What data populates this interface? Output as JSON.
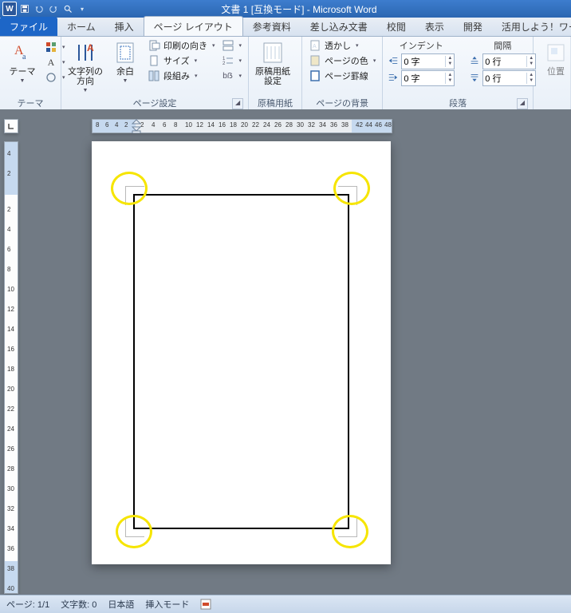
{
  "title": "文書 1 [互換モード] - Microsoft Word",
  "tabs": {
    "file": "ファイル",
    "home": "ホーム",
    "insert": "挿入",
    "pagelayout": "ページ レイアウト",
    "references": "参考資料",
    "mailings": "差し込み文書",
    "review": "校閲",
    "view": "表示",
    "developer": "開発",
    "addon": "活用しよう！ワード"
  },
  "ribbon": {
    "themes": {
      "label": "テーマ",
      "themes_btn": "テーマ",
      "themes_a": "A"
    },
    "pagesetup": {
      "label": "ページ設定",
      "textdir": "文字列の\n方向",
      "margins": "余白",
      "orientation": "印刷の向き",
      "size": "サイズ",
      "columns": "段組み",
      "genkou_btn": "原稿用紙\n設定",
      "genkou_group": "原稿用紙"
    },
    "pagebg": {
      "label": "ページの背景",
      "watermark": "透かし",
      "pagecolor": "ページの色",
      "pageborders": "ページ罫線"
    },
    "paragraph": {
      "label": "段落",
      "indent_title": "インデント",
      "spacing_title": "間隔",
      "indent_left": "0 字",
      "indent_right": "0 字",
      "space_before": "0 行",
      "space_after": "0 行"
    },
    "arrange": {
      "pos": "位置"
    }
  },
  "hruler": {
    "left_margin_ticks": [
      "8",
      "6",
      "4",
      "2"
    ],
    "content_ticks": [
      "2",
      "4",
      "6",
      "8",
      "10",
      "12",
      "14",
      "16",
      "18",
      "20",
      "22",
      "24",
      "26",
      "28",
      "30",
      "32",
      "34",
      "36",
      "38"
    ],
    "right_margin_ticks": [
      "42",
      "44",
      "46",
      "48"
    ]
  },
  "vruler": {
    "top_margin_ticks": [
      "4",
      "2"
    ],
    "content_ticks": [
      "2",
      "4",
      "6",
      "8",
      "10",
      "12",
      "14",
      "16",
      "18",
      "20",
      "22",
      "24",
      "26",
      "28",
      "30",
      "32",
      "34",
      "36",
      "38",
      "40"
    ]
  },
  "status": {
    "page": "ページ: 1/1",
    "words": "文字数: 0",
    "lang": "日本語",
    "mode": "挿入モード"
  }
}
